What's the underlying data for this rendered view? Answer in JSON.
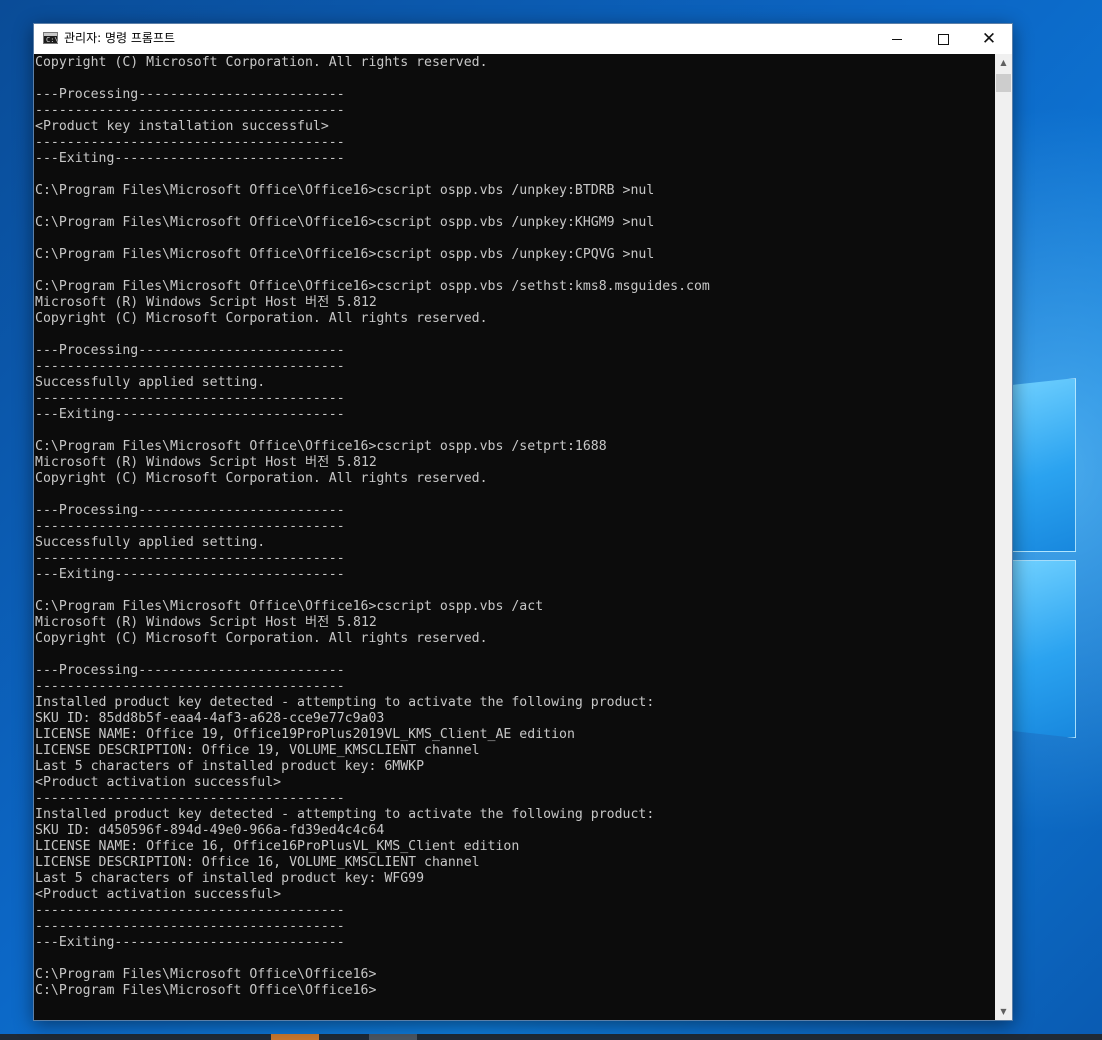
{
  "window": {
    "title": "관리자: 명령 프롬프트",
    "app_icon": "cmd-icon",
    "app_icon_glyph": "C:\\",
    "controls": {
      "minimize_icon": "minimize-icon",
      "maximize_icon": "maximize-icon",
      "close_icon": "close-icon",
      "close_glyph": "✕"
    }
  },
  "console": {
    "background": "#0c0c0c",
    "foreground": "#c7c7c7",
    "lines": [
      "Copyright (C) Microsoft Corporation. All rights reserved.",
      "",
      "---Processing--------------------------",
      "---------------------------------------",
      "<Product key installation successful>",
      "---------------------------------------",
      "---Exiting-----------------------------",
      "",
      "C:\\Program Files\\Microsoft Office\\Office16>cscript ospp.vbs /unpkey:BTDRB >nul",
      "",
      "C:\\Program Files\\Microsoft Office\\Office16>cscript ospp.vbs /unpkey:KHGM9 >nul",
      "",
      "C:\\Program Files\\Microsoft Office\\Office16>cscript ospp.vbs /unpkey:CPQVG >nul",
      "",
      "C:\\Program Files\\Microsoft Office\\Office16>cscript ospp.vbs /sethst:kms8.msguides.com",
      "Microsoft (R) Windows Script Host 버전 5.812",
      "Copyright (C) Microsoft Corporation. All rights reserved.",
      "",
      "---Processing--------------------------",
      "---------------------------------------",
      "Successfully applied setting.",
      "---------------------------------------",
      "---Exiting-----------------------------",
      "",
      "C:\\Program Files\\Microsoft Office\\Office16>cscript ospp.vbs /setprt:1688",
      "Microsoft (R) Windows Script Host 버전 5.812",
      "Copyright (C) Microsoft Corporation. All rights reserved.",
      "",
      "---Processing--------------------------",
      "---------------------------------------",
      "Successfully applied setting.",
      "---------------------------------------",
      "---Exiting-----------------------------",
      "",
      "C:\\Program Files\\Microsoft Office\\Office16>cscript ospp.vbs /act",
      "Microsoft (R) Windows Script Host 버전 5.812",
      "Copyright (C) Microsoft Corporation. All rights reserved.",
      "",
      "---Processing--------------------------",
      "---------------------------------------",
      "Installed product key detected - attempting to activate the following product:",
      "SKU ID: 85dd8b5f-eaa4-4af3-a628-cce9e77c9a03",
      "LICENSE NAME: Office 19, Office19ProPlus2019VL_KMS_Client_AE edition",
      "LICENSE DESCRIPTION: Office 19, VOLUME_KMSCLIENT channel",
      "Last 5 characters of installed product key: 6MWKP",
      "<Product activation successful>",
      "---------------------------------------",
      "Installed product key detected - attempting to activate the following product:",
      "SKU ID: d450596f-894d-49e0-966a-fd39ed4c4c64",
      "LICENSE NAME: Office 16, Office16ProPlusVL_KMS_Client edition",
      "LICENSE DESCRIPTION: Office 16, VOLUME_KMSCLIENT channel",
      "Last 5 characters of installed product key: WFG99",
      "<Product activation successful>",
      "---------------------------------------",
      "---------------------------------------",
      "---Exiting-----------------------------",
      "",
      "C:\\Program Files\\Microsoft Office\\Office16>",
      "C:\\Program Files\\Microsoft Office\\Office16>"
    ]
  },
  "scrollbar": {
    "up_arrow": "▲",
    "down_arrow": "▼"
  }
}
